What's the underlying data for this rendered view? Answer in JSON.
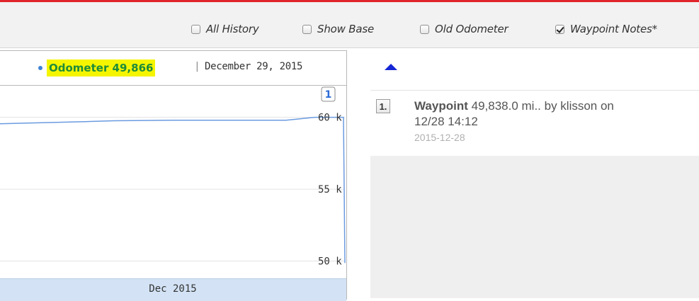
{
  "toolbar": {
    "options": [
      {
        "label": "All History",
        "checked": false
      },
      {
        "label": "Show Base",
        "checked": false
      },
      {
        "label": "Old Odometer",
        "checked": false
      },
      {
        "label": "Waypoint Notes*",
        "checked": true
      }
    ]
  },
  "chart": {
    "header": {
      "odometer": "Odometer 49,866",
      "separator": "|",
      "date": "December 29, 2015"
    },
    "flag": "1",
    "x_period_label": "Dec 2015"
  },
  "chart_data": {
    "type": "line",
    "title": "",
    "xlabel": "",
    "ylabel": "",
    "y_tick_labels": [
      "60 k",
      "55 k",
      "50 k"
    ],
    "y_ticks": [
      60000,
      55000,
      50000
    ],
    "ylim": [
      48800,
      62200
    ],
    "x_period": "Dec 2015",
    "series": [
      {
        "name": "Odometer",
        "values": [
          59550,
          59600,
          59650,
          59700,
          59760,
          59780,
          59800,
          59800,
          59800,
          59800,
          59800,
          60000,
          60000,
          49866
        ]
      }
    ],
    "grid": true,
    "line_color": "#6b9be0"
  },
  "nav": {
    "up_icon": "triangle-up-icon"
  },
  "notes": [
    {
      "number": "1.",
      "title": "Waypoint",
      "summary": "49,838.0 mi.. by klisson on",
      "time": "12/28 14:12",
      "date": "2015-12-28"
    }
  ]
}
